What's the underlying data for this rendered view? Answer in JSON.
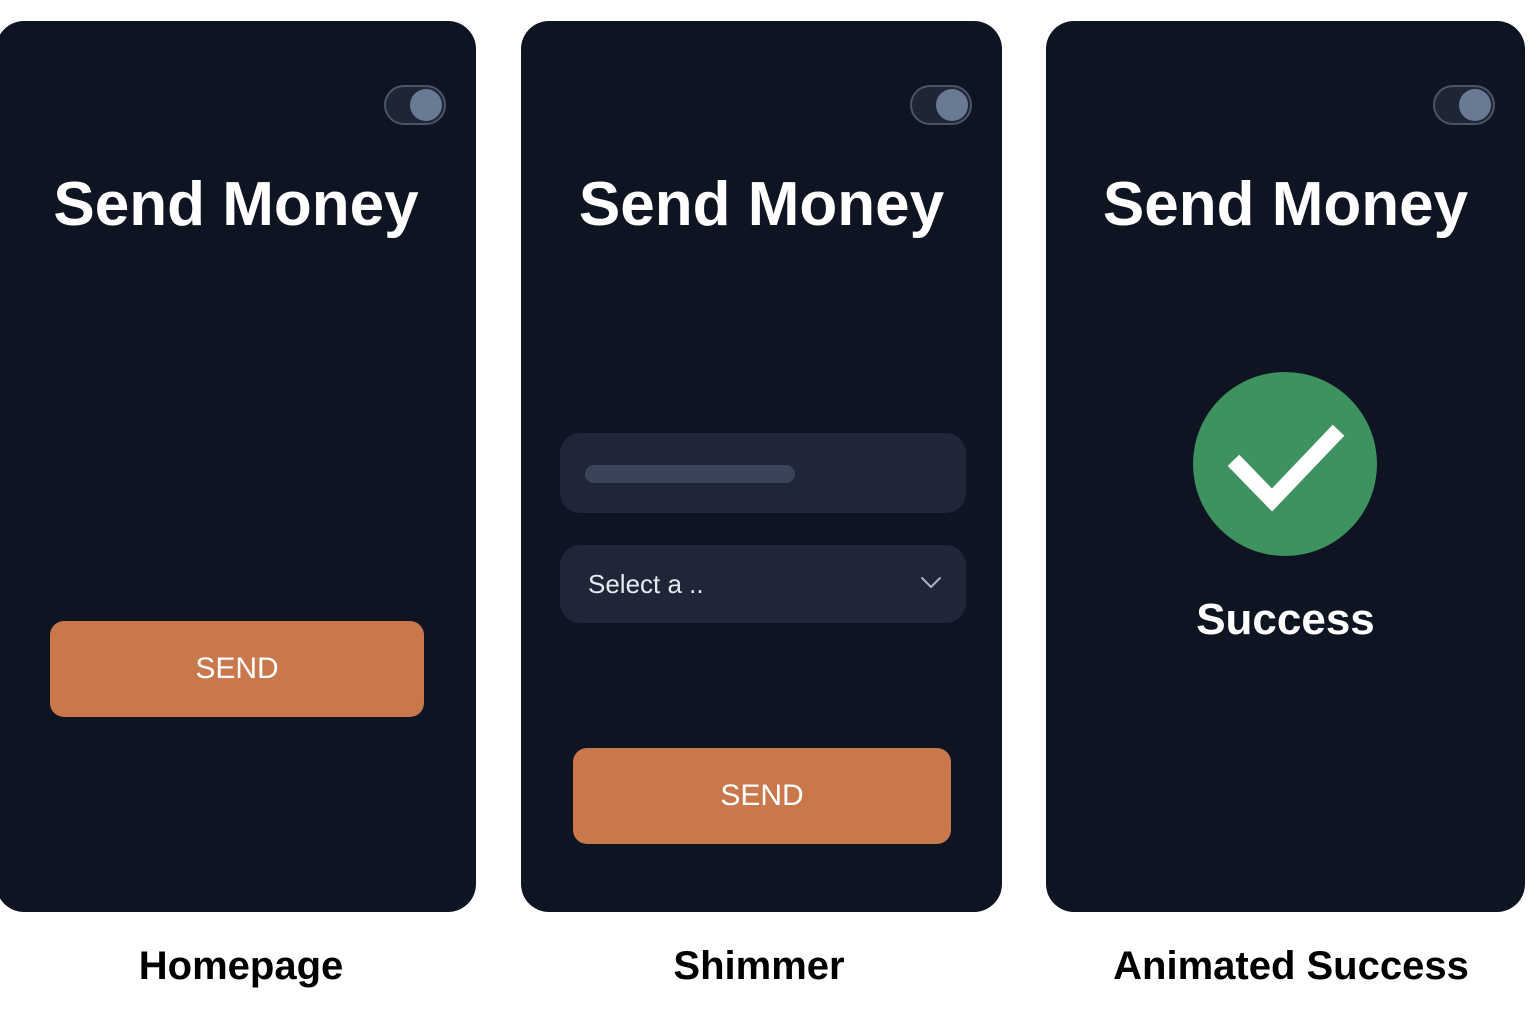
{
  "screens": [
    {
      "caption": "Homepage",
      "title": "Send Money",
      "send_label": "SEND"
    },
    {
      "caption": "Shimmer",
      "title": "Send Money",
      "select_placeholder": "Select a ..",
      "send_label": "SEND"
    },
    {
      "caption": "Animated Success",
      "title": "Send Money",
      "status_text": "Success",
      "status_icon": "checkmark-icon"
    }
  ],
  "colors": {
    "background": "#ffffff",
    "card": "#0f1422",
    "field": "#1e2638",
    "accent": "#c8784a",
    "success": "#3e9260",
    "text": "#ffffff"
  }
}
